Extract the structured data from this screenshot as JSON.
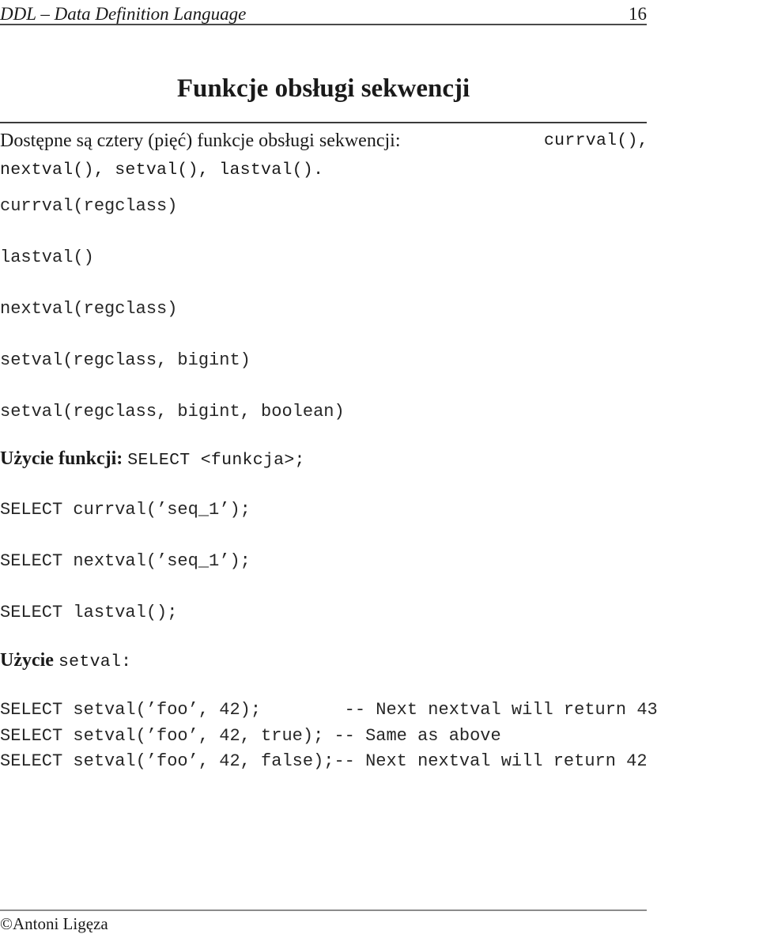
{
  "header": {
    "title": "DDL – Data Definition Language",
    "page_number": "16"
  },
  "slide": {
    "title": "Funkcje obsługi sekwencji",
    "intro": {
      "line1_serif": "Dostępne są cztery (pięć) funkcje obsługi sekwencji:",
      "line1_mono": "currval(),",
      "line2_mono": "nextval(), setval(), lastval()."
    },
    "signatures": [
      "currval(regclass)",
      "lastval()",
      "nextval(regclass)",
      "setval(regclass, bigint)",
      "setval(regclass, bigint, boolean)"
    ],
    "usage_funkcji": {
      "label": "Użycie funkcji:",
      "code": "SELECT <funkcja>;"
    },
    "select_examples": [
      "SELECT currval(’seq_1’);",
      "SELECT nextval(’seq_1’);",
      "SELECT lastval();"
    ],
    "usage_setval": {
      "label": "Użycie",
      "code": "setval:"
    },
    "setval_block": [
      "SELECT setval(’foo’, 42);        -- Next nextval will return 43",
      "SELECT setval(’foo’, 42, true); -- Same as above",
      "SELECT setval(’foo’, 42, false);-- Next nextval will return 42"
    ]
  },
  "footer": {
    "copyright": "©Antoni Ligęza"
  }
}
